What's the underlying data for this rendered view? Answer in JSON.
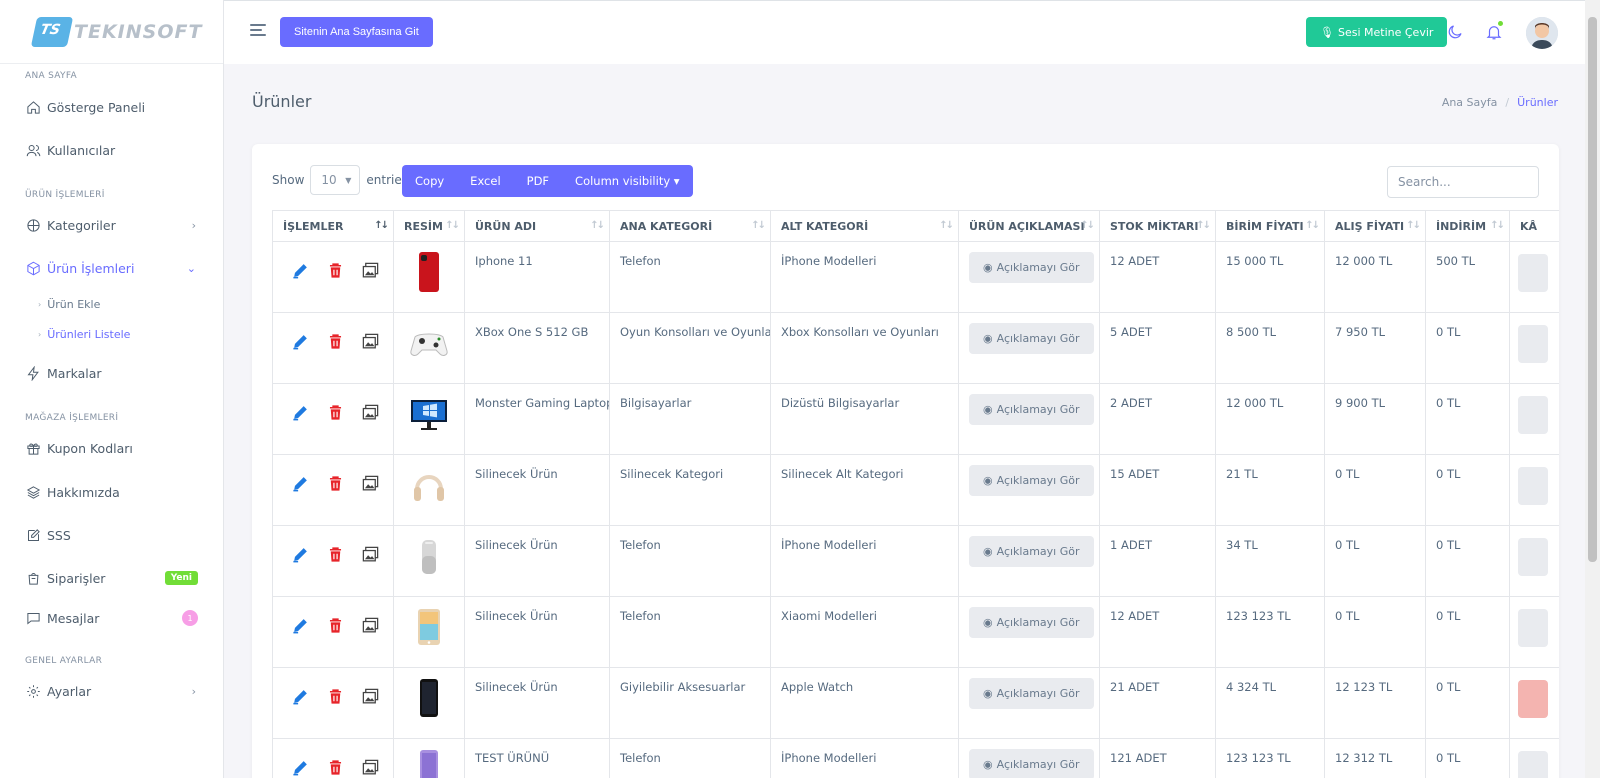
{
  "brand": {
    "name": "TEKINSOFT",
    "mark": "TS"
  },
  "sidebar": {
    "headers": [
      "ANA SAYFA",
      "ÜRÜN İŞLEMLERİ",
      "MAĞAZA İŞLEMLERİ",
      "GENEL AYARLAR"
    ],
    "items": {
      "dashboard": "Gösterge Paneli",
      "users": "Kullanıcılar",
      "categories": "Kategoriler",
      "product_ops": "Ürün İşlemleri",
      "product_add": "Ürün Ekle",
      "product_list": "Ürünleri Listele",
      "brands": "Markalar",
      "coupons": "Kupon Kodları",
      "about": "Hakkımızda",
      "faq": "SSS",
      "orders": "Siparişler",
      "messages": "Mesajlar",
      "settings": "Ayarlar"
    },
    "orders_badge": "Yeni",
    "messages_badge": "1"
  },
  "navbar": {
    "site_button": "Sitenin Ana Sayfasına Git",
    "speech_button": "Sesi Metine Çevir"
  },
  "page": {
    "title": "Ürünler",
    "breadcrumb": [
      "Ana Sayfa",
      "Ürünler"
    ]
  },
  "table_controls": {
    "show": "Show",
    "entries_value": "10",
    "entries": "entries",
    "buttons": [
      "Copy",
      "Excel",
      "PDF",
      "Column visibility ▾"
    ],
    "search_placeholder": "Search..."
  },
  "columns": [
    "İŞLEMLER",
    "RESİM",
    "ÜRÜN ADI",
    "ANA KATEGORİ",
    "ALT KATEGORİ",
    "ÜRÜN AÇIKLAMASI",
    "STOK MİKTARI",
    "BİRİM FİYATI",
    "ALIŞ FİYATI",
    "İNDİRİM",
    "KÂ"
  ],
  "desc_button_label": "Açıklamayı Gör",
  "rows": [
    {
      "image": "red-phone",
      "name": "Iphone 11",
      "main_cat": "Telefon",
      "sub_cat": "İPhone Modelleri",
      "stock": "12 ADET",
      "unit_price": "15 000 TL",
      "buy_price": "12 000 TL",
      "discount": "500 TL",
      "profit_status": "neutral"
    },
    {
      "image": "game-controller",
      "name": "XBox One S 512 GB",
      "main_cat": "Oyun Konsolları ve Oyunlar",
      "sub_cat": "Xbox Konsolları ve Oyunları",
      "stock": "5 ADET",
      "unit_price": "8 500 TL",
      "buy_price": "7 950 TL",
      "discount": "0 TL",
      "profit_status": "neutral"
    },
    {
      "image": "monitor",
      "name": "Monster Gaming Laptop",
      "main_cat": "Bilgisayarlar",
      "sub_cat": "Dizüstü Bilgisayarlar",
      "stock": "2 ADET",
      "unit_price": "12 000 TL",
      "buy_price": "9 900 TL",
      "discount": "0 TL",
      "profit_status": "neutral"
    },
    {
      "image": "headphones",
      "name": "Silinecek Ürün",
      "main_cat": "Silinecek Kategori",
      "sub_cat": "Silinecek Alt Kategori",
      "stock": "15 ADET",
      "unit_price": "21 TL",
      "buy_price": "0 TL",
      "discount": "0 TL",
      "profit_status": "neutral"
    },
    {
      "image": "smart-speaker",
      "name": "Silinecek Ürün",
      "main_cat": "Telefon",
      "sub_cat": "İPhone Modelleri",
      "stock": "1 ADET",
      "unit_price": "34 TL",
      "buy_price": "0 TL",
      "discount": "0 TL",
      "profit_status": "neutral"
    },
    {
      "image": "tablet",
      "name": "Silinecek Ürün",
      "main_cat": "Telefon",
      "sub_cat": "Xiaomi Modelleri",
      "stock": "12 ADET",
      "unit_price": "123 123 TL",
      "buy_price": "0 TL",
      "discount": "0 TL",
      "profit_status": "neutral"
    },
    {
      "image": "black-phone",
      "name": "Silinecek Ürün",
      "main_cat": "Giyilebilir Aksesuarlar",
      "sub_cat": "Apple Watch",
      "stock": "21 ADET",
      "unit_price": "4 324 TL",
      "buy_price": "12 123 TL",
      "discount": "0 TL",
      "profit_status": "loss"
    },
    {
      "image": "purple-phone",
      "name": "TEST ÜRÜNÜ",
      "main_cat": "Telefon",
      "sub_cat": "İPhone Modelleri",
      "stock": "121 ADET",
      "unit_price": "123 123 TL",
      "buy_price": "12 312 TL",
      "discount": "0 TL",
      "profit_status": "neutral"
    }
  ],
  "colors": {
    "primary": "#696cff",
    "success": "#20c997",
    "danger": "#ff3e1d",
    "badge_new": "#71dd37",
    "badge_msg": "#f79ee6"
  }
}
